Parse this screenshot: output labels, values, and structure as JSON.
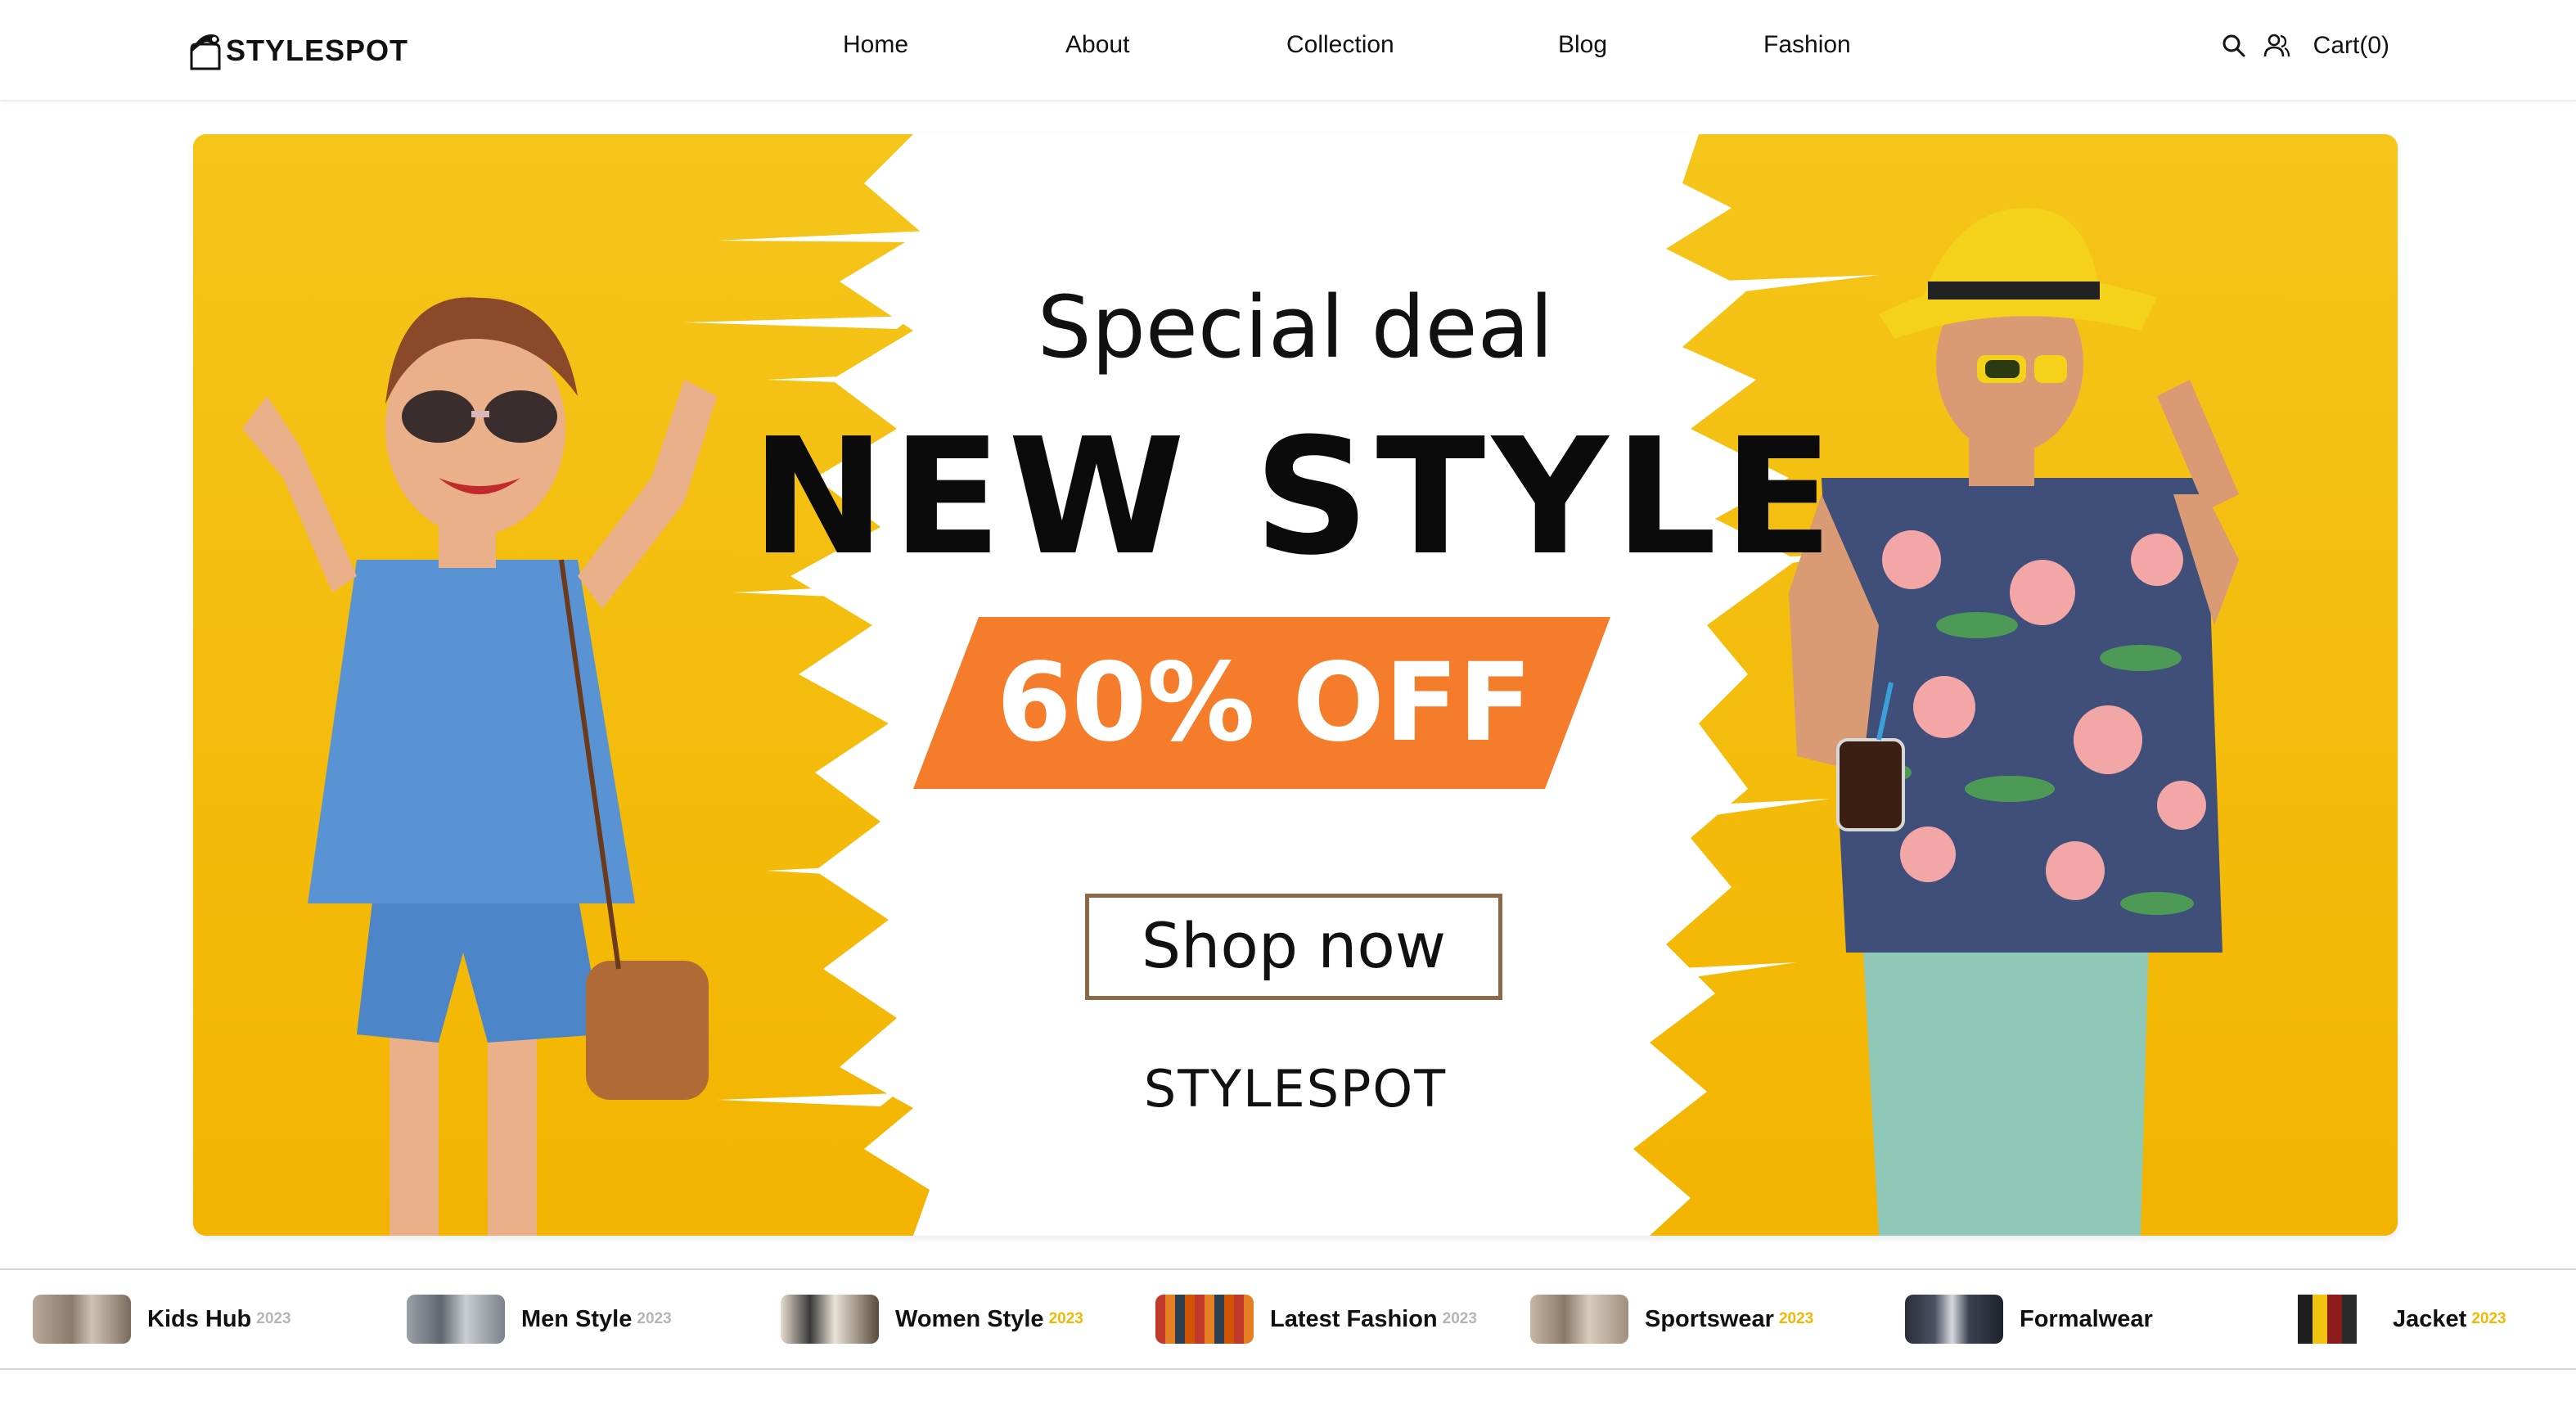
{
  "header": {
    "logo_text": "STYLESPOT",
    "logo_icon": "hanger-bag-icon",
    "nav": [
      "Home",
      "About",
      "Collection",
      "Blog",
      "Fashion"
    ],
    "search_icon": "search-icon",
    "user_icon": "user-icon",
    "cart_label": "Cart(0)"
  },
  "hero": {
    "kicker": "Special deal",
    "headline": "NEW STYLE",
    "discount": "60% OFF",
    "cta": "Shop now",
    "brand": "STYLESPOT",
    "colors": {
      "accent_yellow": "#f9c80c",
      "offer_orange": "#f57c2b",
      "button_border": "#8b6a47"
    }
  },
  "categories": [
    {
      "label": "Kids Hub",
      "year": "2023",
      "year_color": "#b5b5b5"
    },
    {
      "label": "Men Style",
      "year": "2023",
      "year_color": "#b5b5b5"
    },
    {
      "label": "Women Style",
      "year": "2023",
      "year_color": "#f2b705"
    },
    {
      "label": "Latest Fashion",
      "year": "2023",
      "year_color": "#b5b5b5"
    },
    {
      "label": "Sportswear",
      "year": "2023",
      "year_color": "#f2b705"
    },
    {
      "label": "Formalwear",
      "year": "",
      "year_color": "#b5b5b5"
    },
    {
      "label": "Jacket",
      "year": "2023",
      "year_color": "#f2b705"
    }
  ]
}
